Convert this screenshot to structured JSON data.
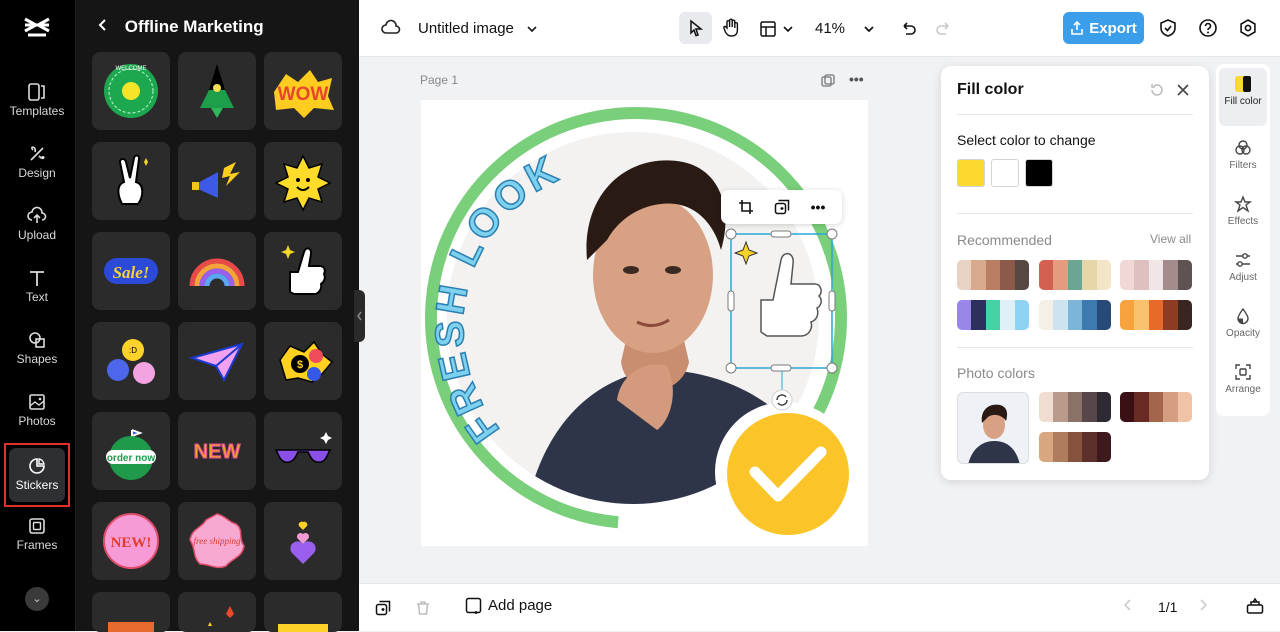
{
  "rail": {
    "items": [
      {
        "label": "Templates",
        "icon": "templates-icon"
      },
      {
        "label": "Design",
        "icon": "design-icon"
      },
      {
        "label": "Upload",
        "icon": "upload-icon"
      },
      {
        "label": "Text",
        "icon": "text-icon"
      },
      {
        "label": "Shapes",
        "icon": "shapes-icon"
      },
      {
        "label": "Photos",
        "icon": "photos-icon"
      },
      {
        "label": "Stickers",
        "icon": "stickers-icon"
      },
      {
        "label": "Frames",
        "icon": "frames-icon"
      }
    ],
    "active": "Stickers"
  },
  "panel": {
    "title": "Offline Marketing",
    "stickers": [
      {
        "text": "WELCOME"
      },
      {
        "text": ""
      },
      {
        "text": "WOW"
      },
      {
        "text": ""
      },
      {
        "text": ""
      },
      {
        "text": ""
      },
      {
        "text": "Sale!"
      },
      {
        "text": ""
      },
      {
        "text": ""
      },
      {
        "text": ":D"
      },
      {
        "text": ""
      },
      {
        "text": "$"
      },
      {
        "text": "order now"
      },
      {
        "text": "NEW"
      },
      {
        "text": ""
      },
      {
        "text": "NEW!"
      },
      {
        "text": "free shipping"
      },
      {
        "text": ""
      }
    ]
  },
  "topbar": {
    "doc_title": "Untitled image",
    "zoom": "41%",
    "export_label": "Export",
    "accent": "#3b9eea"
  },
  "canvas": {
    "page_label": "Page 1",
    "image_text": "FRESH LOOK"
  },
  "fill_panel": {
    "title": "Fill color",
    "select_label": "Select color to change",
    "selected_colors": [
      "#fcd92f",
      "#ffffff",
      "#000000"
    ],
    "recommended_label": "Recommended",
    "view_all": "View all",
    "recommended_palettes": [
      [
        "#e7d2c4",
        "#d9a98d",
        "#b87d62",
        "#8b5a4a",
        "#574742"
      ],
      [
        "#d4604f",
        "#e39d7e",
        "#6aa693",
        "#e7d6a8",
        "#f3e5c6"
      ],
      [
        "#f2d7d7",
        "#dfc0c0",
        "#f2e5e5",
        "#a48c8c",
        "#5e5252"
      ],
      [
        "#9a86e8",
        "#2d2f5e",
        "#47d1a6",
        "#dfeff8",
        "#8fd3f4"
      ],
      [
        "#f5f0e6",
        "#cde3ef",
        "#7db4da",
        "#3c7ab0",
        "#274a78"
      ],
      [
        "#f6a33d",
        "#fac26e",
        "#e86a2b",
        "#8b3c22",
        "#3a2620"
      ]
    ],
    "photo_colors_label": "Photo colors",
    "photo_palettes": [
      [
        "#f0ddd2",
        "#b89b8c",
        "#8a7268",
        "#57474a",
        "#2d2a33"
      ],
      [
        "#3a1015",
        "#6a2a24",
        "#a4654d",
        "#d69e80",
        "#f1c3a6"
      ],
      [
        "#d9a77f",
        "#b07c5e",
        "#86543e",
        "#5d2f2a",
        "#3e1a1f"
      ]
    ]
  },
  "tools": [
    {
      "label": "Fill color",
      "icon": "fill-color-icon"
    },
    {
      "label": "Filters",
      "icon": "filters-icon"
    },
    {
      "label": "Effects",
      "icon": "effects-icon"
    },
    {
      "label": "Adjust",
      "icon": "adjust-icon"
    },
    {
      "label": "Opacity",
      "icon": "opacity-icon"
    },
    {
      "label": "Arrange",
      "icon": "arrange-icon"
    }
  ],
  "bottombar": {
    "add_page": "Add page",
    "page_indicator": "1/1"
  }
}
